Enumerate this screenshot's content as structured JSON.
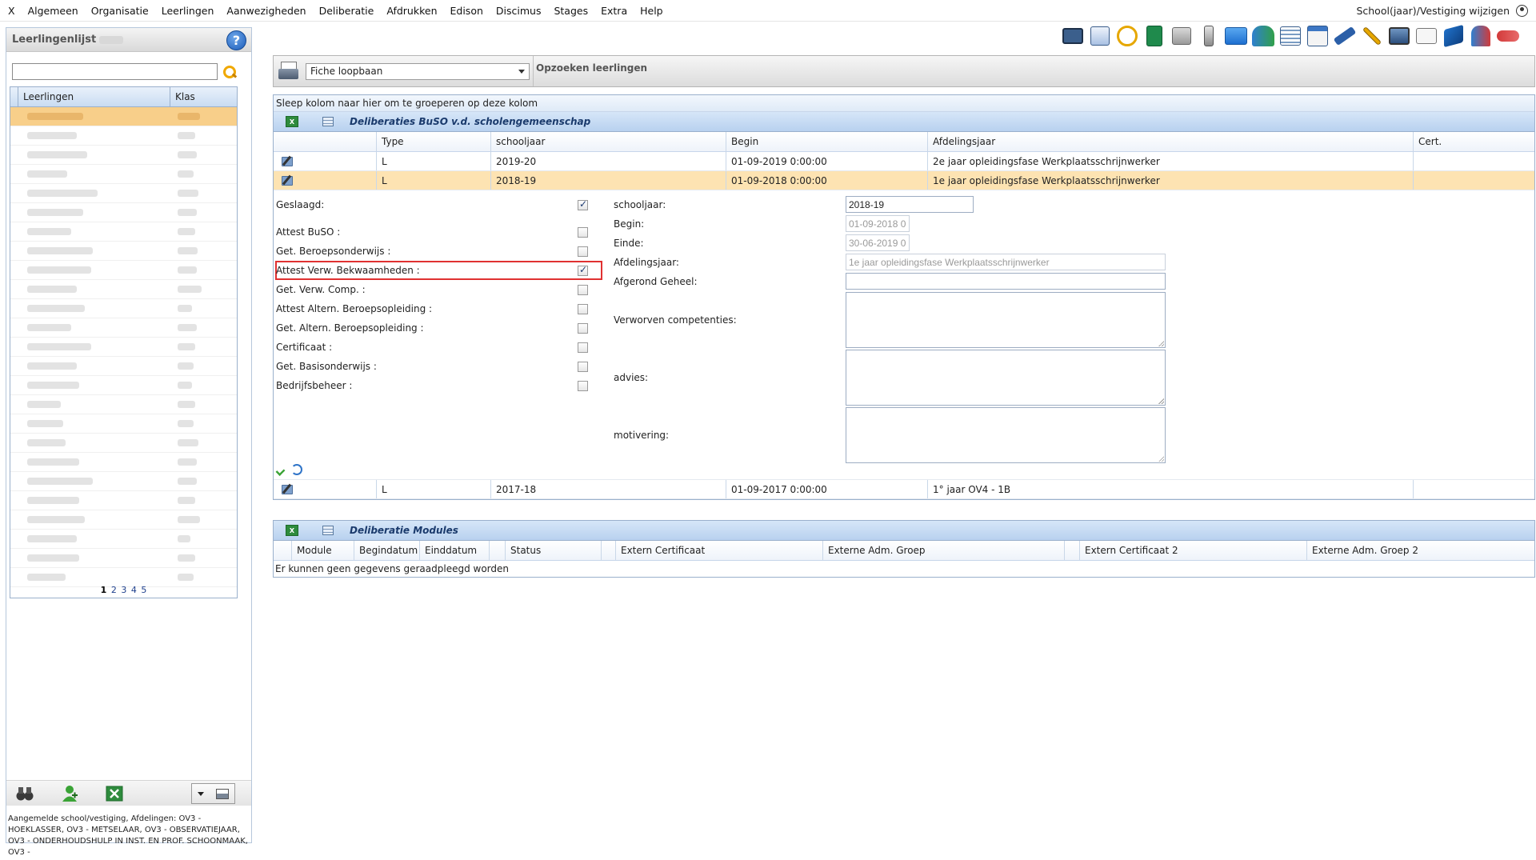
{
  "menu": {
    "items": [
      "X",
      "Algemeen",
      "Organisatie",
      "Leerlingen",
      "Aanwezigheden",
      "Deliberatie",
      "Afdrukken",
      "Edison",
      "Discimus",
      "Stages",
      "Extra",
      "Help"
    ],
    "right_label": "School(jaar)/Vestiging wijzigen"
  },
  "toolbar_icons": [
    "id-card-icon",
    "edit-form-icon",
    "clock-icon",
    "calculator-icon",
    "home-icon",
    "phone-icon",
    "mail-icon",
    "users-icon",
    "report-icon",
    "calendar-icon",
    "ruler-icon",
    "tools-icon",
    "screen-icon",
    "certificate-icon",
    "book-icon",
    "user-lock-icon",
    "gok-icon"
  ],
  "leftpanel": {
    "title": "Leerlingenlijst",
    "search_value": "",
    "columns": [
      "Leerlingen",
      "Klas"
    ],
    "row_count": 25,
    "selected_row": 0,
    "pages": [
      "1",
      "2",
      "3",
      "4",
      "5"
    ],
    "status": "Aangemelde school/vestiging, Afdelingen: OV3 - HOEKLASSER, OV3 - METSELAAR, OV3 - OBSERVATIEJAAR, OV3 - ONDERHOUDSHULP IN INST. EN PROF. SCHOONMAAK, OV3 -"
  },
  "topbar": {
    "select_value": "Fiche loopbaan",
    "title": "Opzoeken leerlingen"
  },
  "deliberaties": {
    "group_hint": "Sleep kolom naar hier om te groeperen op deze kolom",
    "section_title": "Deliberaties BuSO v.d. scholengemeenschap",
    "columns": [
      "",
      "Type",
      "schooljaar",
      "Begin",
      "Afdelingsjaar",
      "Cert."
    ],
    "rows": [
      {
        "type": "L",
        "schooljaar": "2019-20",
        "begin": "01-09-2019 0:00:00",
        "afdelingsjaar": "2e jaar opleidingsfase Werkplaatsschrijnwerker",
        "cert": ""
      },
      {
        "type": "L",
        "schooljaar": "2018-19",
        "begin": "01-09-2018 0:00:00",
        "afdelingsjaar": "1e jaar opleidingsfase Werkplaatsschrijnwerker",
        "cert": ""
      },
      {
        "type": "L",
        "schooljaar": "2017-18",
        "begin": "01-09-2017 0:00:00",
        "afdelingsjaar": "1° jaar OV4 - 1B",
        "cert": ""
      }
    ],
    "form": {
      "geslaagd_label": "Geslaagd:",
      "checks": [
        {
          "label": "Attest BuSO :",
          "checked": false
        },
        {
          "label": "Get. Beroepsonderwijs :",
          "checked": false
        },
        {
          "label": "Attest Verw. Bekwaamheden :",
          "checked": true
        },
        {
          "label": "Get. Verw. Comp. :",
          "checked": false
        },
        {
          "label": "Attest Altern. Beroepsopleiding :",
          "checked": false
        },
        {
          "label": "Get. Altern. Beroepsopleiding :",
          "checked": false
        },
        {
          "label": "Certificaat :",
          "checked": false
        },
        {
          "label": "Get. Basisonderwijs :",
          "checked": false
        },
        {
          "label": "Bedrijfsbeheer :",
          "checked": false
        }
      ],
      "geslaagd_checked": true,
      "schooljaar_label": "schooljaar:",
      "schooljaar_value": "2018-19",
      "begin_label": "Begin:",
      "begin_value": "01-09-2018 0:",
      "einde_label": "Einde:",
      "einde_value": "30-06-2019 0:",
      "afdelingsjaar_label": "Afdelingsjaar:",
      "afdelingsjaar_value": "1e jaar opleidingsfase Werkplaatsschrijnwerker",
      "afgerond_label": "Afgerond Geheel:",
      "afgerond_value": "",
      "verworven_label": "Verworven competenties:",
      "advies_label": "advies:",
      "motivering_label": "motivering:"
    }
  },
  "modules": {
    "section_title": "Deliberatie Modules",
    "columns": [
      "Module",
      "Begindatum",
      "Einddatum",
      "Status",
      "Extern Certificaat",
      "Externe Adm. Groep",
      "Extern Certificaat 2",
      "Externe Adm. Groep 2"
    ],
    "empty_text": "Er kunnen geen gegevens geraadpleegd worden"
  },
  "colors": {
    "selected_row": "#fde3b2",
    "section_title": "#1a3a6c",
    "highlight_border": "#e03131"
  }
}
